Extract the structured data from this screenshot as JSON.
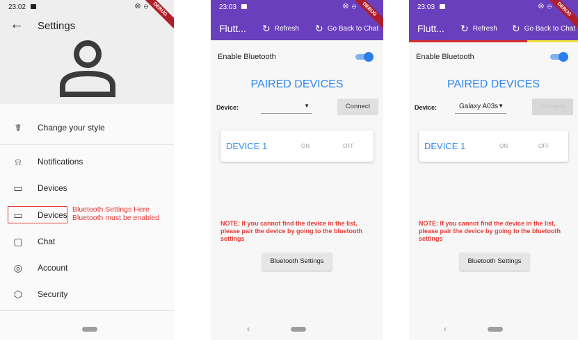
{
  "phone1": {
    "status_time": "23:02",
    "title": "Settings",
    "menu": [
      {
        "label": "Change your style",
        "icon": "paint-roller-icon"
      },
      {
        "label": "Notifications",
        "icon": "bell-icon"
      },
      {
        "label": "Devices",
        "icon": "devices-icon"
      },
      {
        "label": "Devices",
        "icon": "devices-icon"
      },
      {
        "label": "Chat",
        "icon": "chat-bubble-icon"
      },
      {
        "label": "Account",
        "icon": "account-circle-icon"
      },
      {
        "label": "Security",
        "icon": "shield-icon"
      }
    ],
    "annotation_line1": "Bluetooth Settings Here",
    "annotation_line2": "Bluetooth must be enabled"
  },
  "phone2": {
    "status_time": "23:03",
    "app_title": "Flutt...",
    "refresh_label": "Refresh",
    "chat_label": "Go Back to Chat",
    "enable_bt_label": "Enable Bluetooth",
    "paired_title": "PAIRED DEVICES",
    "device_label": "Device:",
    "dropdown_value": "",
    "connect_label": "Connect",
    "card_device": "DEVICE 1",
    "card_on": "ON",
    "card_off": "OFF",
    "note": "NOTE: If you cannot find the device in the list, please pair the device by going to the bluetooth settings",
    "bt_settings_label": "Bluetooth Settings"
  },
  "phone3": {
    "status_time": "23:03",
    "app_title": "Flutt...",
    "refresh_label": "Refresh",
    "chat_label": "Go Back to Chat",
    "enable_bt_label": "Enable Bluetooth",
    "paired_title": "PAIRED DEVICES",
    "device_label": "Device:",
    "dropdown_value": "Galaxy A03s",
    "connect_label": "Connect",
    "card_device": "DEVICE 1",
    "card_on": "ON",
    "card_off": "OFF",
    "note": "NOTE: If you cannot find the device in the list, please pair the device by going to the bluetooth settings",
    "bt_settings_label": "Bluetooth Settings"
  },
  "debug_banner": "DEBUG",
  "colors": {
    "appbar": "#6a3fbd",
    "accent": "#2f87ee",
    "note_red": "#e53935"
  }
}
